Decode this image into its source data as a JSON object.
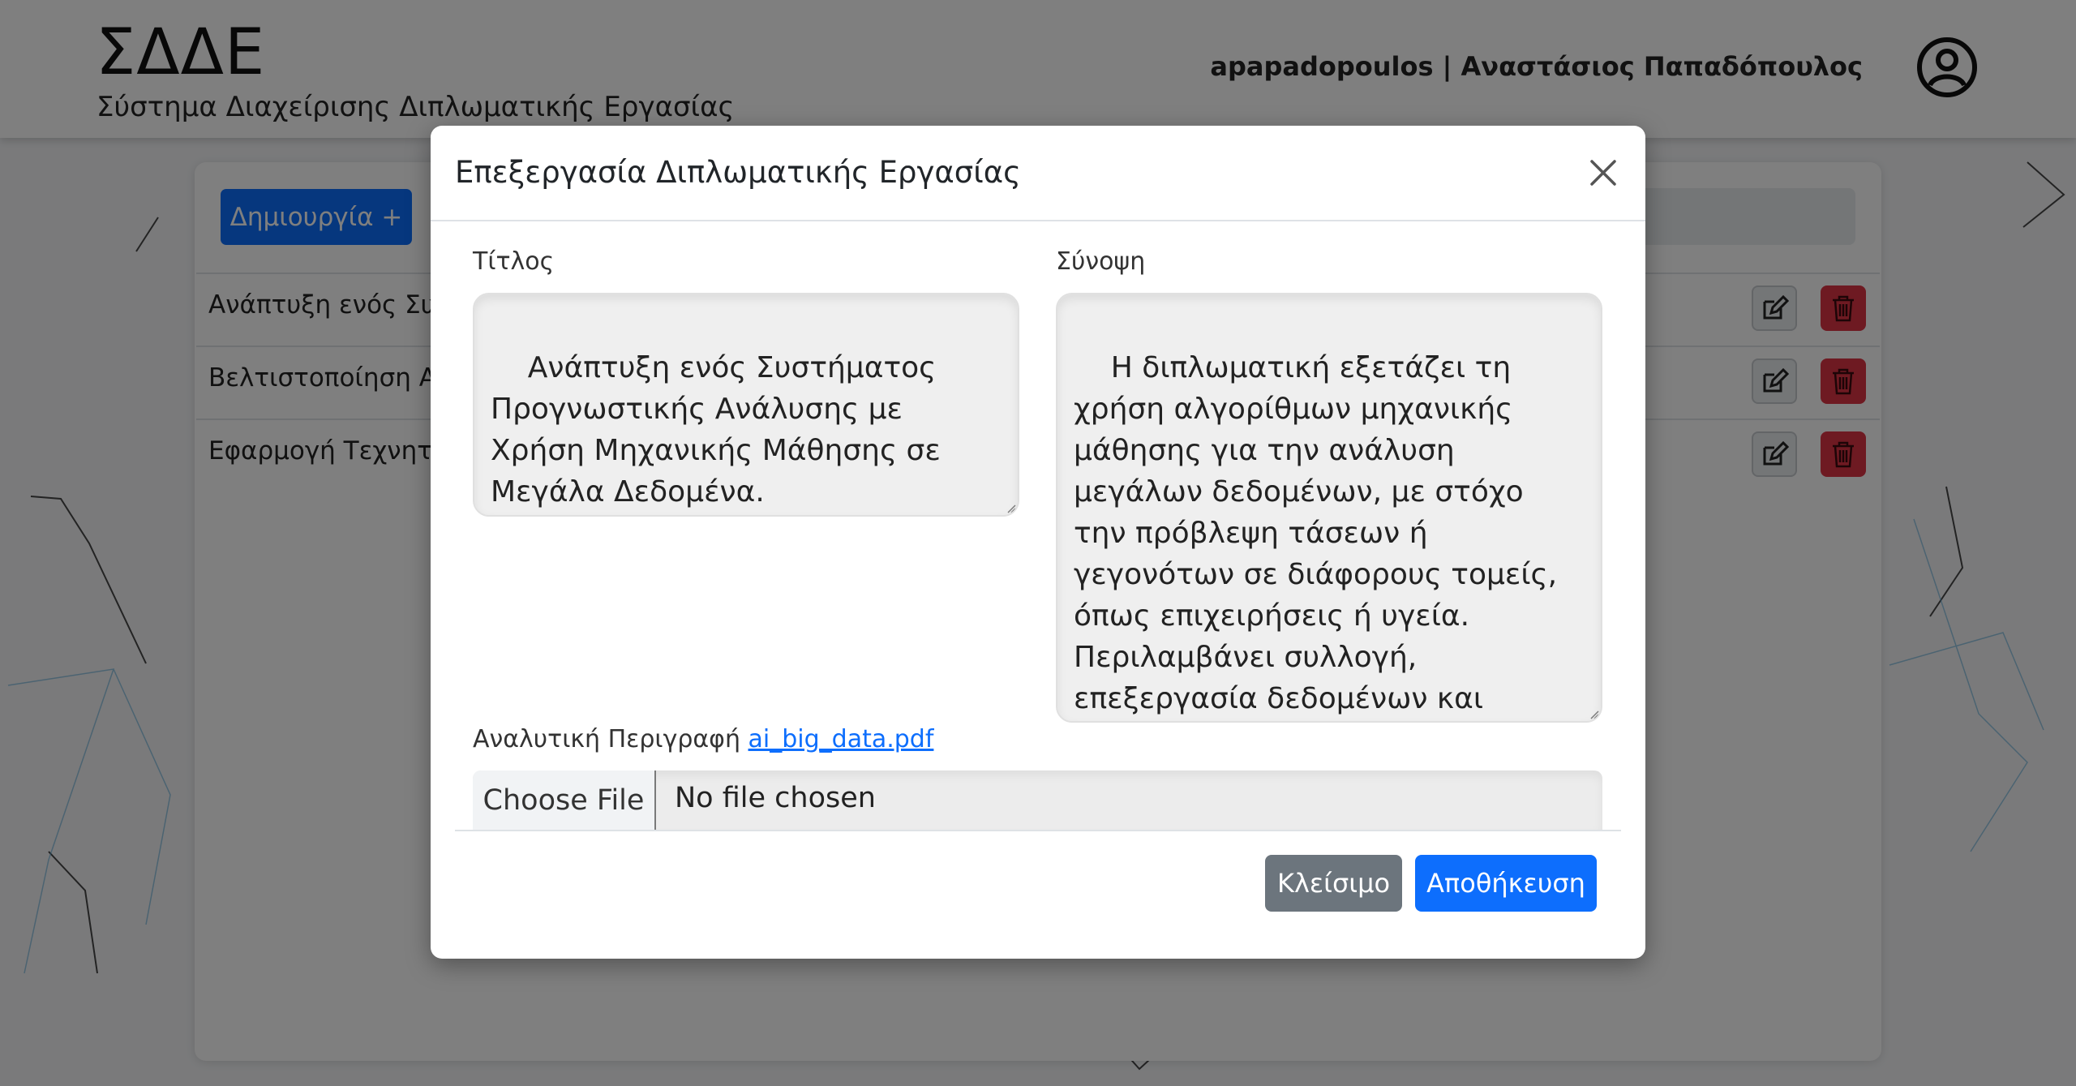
{
  "app": {
    "logo": "ΣΔΔΕ",
    "subtitle": "Σύστημα Διαχείρισης Διπλωματικής Εργασίας",
    "user": "apapadopoulos | Αναστάσιος Παπαδόπουλος"
  },
  "list": {
    "create_label": "Δημιουργία +",
    "rows": [
      {
        "title": "Ανάπτυξη ενός Συστήματος Προγνωστικής Ανάλυσης με Χρήση Μηχανικής Μάθησης σε Μεγάλα Δεδομένα."
      },
      {
        "title": "Βελτιστοποίηση Αλγορίθμων"
      },
      {
        "title": "Εφαρμογή Τεχνητής Νοημοσύνης"
      }
    ]
  },
  "modal": {
    "title": "Επεξεργασία Διπλωματικής Εργασίας",
    "title_label": "Τίτλος",
    "title_value": "Ανάπτυξη ενός Συστήματος Προγνωστικής Ανάλυσης με Χρήση Μηχανικής Μάθησης σε Μεγάλα Δεδομένα.",
    "summary_label": "Σύνοψη",
    "summary_value": "Η διπλωματική εξετάζει τη χρήση αλγορίθμων μηχανικής μάθησης για την ανάλυση μεγάλων δεδομένων, με στόχο την πρόβλεψη τάσεων ή γεγονότων σε διάφορους τομείς, όπως επιχειρήσεις ή υγεία. Περιλαμβάνει συλλογή, επεξεργασία δεδομένων και αξιολόγηση μοντέλων.",
    "description_label": "Αναλυτική Περιγραφή",
    "description_file": "ai_big_data.pdf",
    "choose_file_label": "Choose File",
    "no_file_text": "No file chosen",
    "close_label": "Κλείσιμο",
    "save_label": "Αποθήκευση"
  },
  "colors": {
    "primary": "#0d6efd",
    "secondary": "#6c757d",
    "danger": "#dc3545"
  }
}
